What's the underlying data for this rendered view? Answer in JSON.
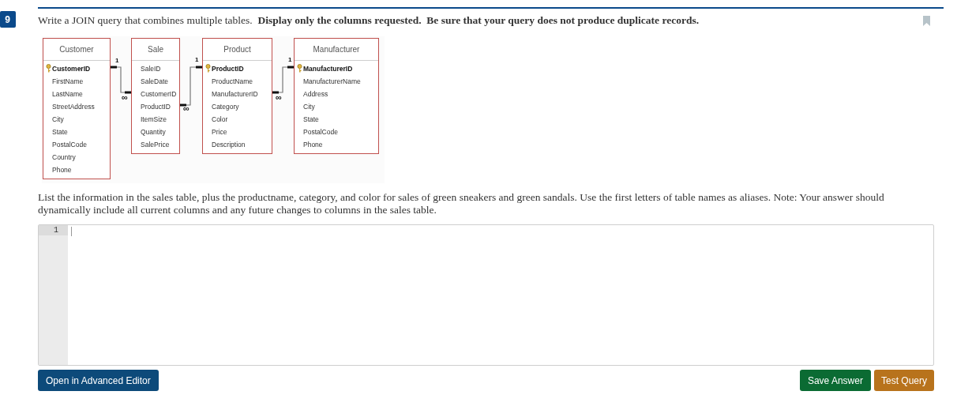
{
  "question": {
    "number": "9",
    "prompt": "Write a JOIN query that combines multiple tables.  **Display only the columns requested.  Be sure that your query does not produce duplicate records.**",
    "bookmarked": false
  },
  "diagram": {
    "tables": [
      {
        "name": "Customer",
        "fields": [
          {
            "name": "CustomerID",
            "primary_key": true
          },
          {
            "name": "FirstName",
            "primary_key": false
          },
          {
            "name": "LastName",
            "primary_key": false
          },
          {
            "name": "StreetAddress",
            "primary_key": false
          },
          {
            "name": "City",
            "primary_key": false
          },
          {
            "name": "State",
            "primary_key": false
          },
          {
            "name": "PostalCode",
            "primary_key": false
          },
          {
            "name": "Country",
            "primary_key": false
          },
          {
            "name": "Phone",
            "primary_key": false
          }
        ]
      },
      {
        "name": "Sale",
        "fields": [
          {
            "name": "SaleID",
            "primary_key": false
          },
          {
            "name": "SaleDate",
            "primary_key": false
          },
          {
            "name": "CustomerID",
            "primary_key": false
          },
          {
            "name": "ProductID",
            "primary_key": false
          },
          {
            "name": "ItemSize",
            "primary_key": false
          },
          {
            "name": "Quantity",
            "primary_key": false
          },
          {
            "name": "SalePrice",
            "primary_key": false
          }
        ]
      },
      {
        "name": "Product",
        "fields": [
          {
            "name": "ProductID",
            "primary_key": true
          },
          {
            "name": "ProductName",
            "primary_key": false
          },
          {
            "name": "ManufacturerID",
            "primary_key": false
          },
          {
            "name": "Category",
            "primary_key": false
          },
          {
            "name": "Color",
            "primary_key": false
          },
          {
            "name": "Price",
            "primary_key": false
          },
          {
            "name": "Description",
            "primary_key": false
          }
        ]
      },
      {
        "name": "Manufacturer",
        "fields": [
          {
            "name": "ManufacturerID",
            "primary_key": true
          },
          {
            "name": "ManufacturerName",
            "primary_key": false
          },
          {
            "name": "Address",
            "primary_key": false
          },
          {
            "name": "City",
            "primary_key": false
          },
          {
            "name": "State",
            "primary_key": false
          },
          {
            "name": "PostalCode",
            "primary_key": false
          },
          {
            "name": "Phone",
            "primary_key": false
          }
        ]
      }
    ],
    "relationships": [
      {
        "one_label": "1",
        "many_label": "∞"
      },
      {
        "one_label": "1",
        "many_label": "∞"
      },
      {
        "one_label": "1",
        "many_label": "∞"
      }
    ]
  },
  "instructions": "List the information in the sales table, plus the productname, category, and color for sales of green sneakers and green sandals. Use the first letters of table names as aliases. Note: Your answer should dynamically include all current columns and any future changes to columns in the sales table.",
  "editor": {
    "line_numbers": [
      "1"
    ]
  },
  "buttons": {
    "advanced": "Open in Advanced Editor",
    "save": "Save Answer",
    "test": "Test Query"
  }
}
